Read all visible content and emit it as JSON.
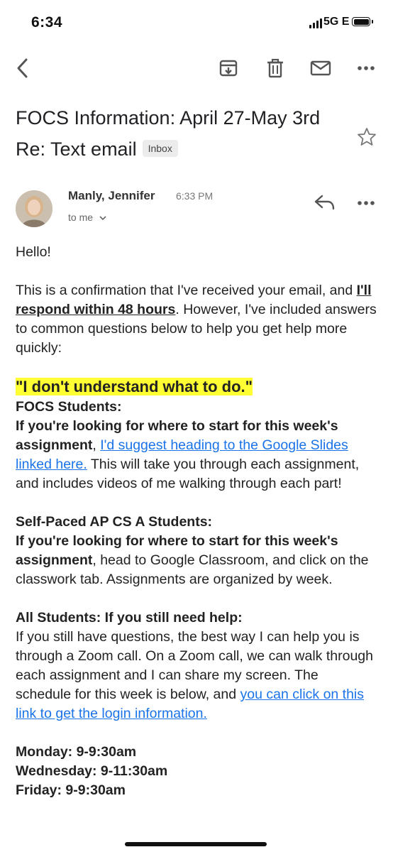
{
  "status_bar": {
    "time": "6:34",
    "network": "5G E"
  },
  "toolbar": {
    "back_icon": "chevron-left-icon",
    "archive_icon": "archive-icon",
    "delete_icon": "trash-icon",
    "mark_unread_icon": "mail-icon",
    "more_icon": "more-horizontal-icon"
  },
  "email": {
    "subject": "FOCS Information: April 27-May 3rd Re: Text email",
    "label": "Inbox",
    "sender": "Manly, Jennifer",
    "time": "6:33 PM",
    "recipient": "to me"
  },
  "body": {
    "greeting": "Hello!",
    "p1_a": "This is a confirmation that I've received your email, and ",
    "p1_bold": "I'll respond within 48 hours",
    "p1_b": ". However, I've included answers to common questions below to help you get help more quickly:",
    "highlight": "\"I don't understand what to do.\"",
    "focs_heading": "FOCS Students:",
    "focs_bold": "If you're looking for where to start for this week's assignment",
    "focs_sep": ", ",
    "focs_link": "I'd suggest heading to the Google Slides linked here.",
    "focs_rest": " This will take you through each assignment, and includes videos of me walking through each part!",
    "ap_heading": "Self-Paced AP CS A Students:",
    "ap_bold": "If you're looking for where to start for this week's assignment",
    "ap_rest": ", head to Google Classroom, and click on the classwork tab. Assignments are organized by week.",
    "all_heading": "All Students: If you still need help:",
    "all_text": "If you still have questions, the best way I can help you is through a Zoom call. On a Zoom call, we can walk through each assignment and I can share my screen. The schedule for this week is below, and ",
    "all_link": "you can click on this link to get the login information.",
    "schedule": [
      "Monday: 9-9:30am",
      "Wednesday: 9-11:30am",
      "Friday: 9-9:30am"
    ]
  }
}
